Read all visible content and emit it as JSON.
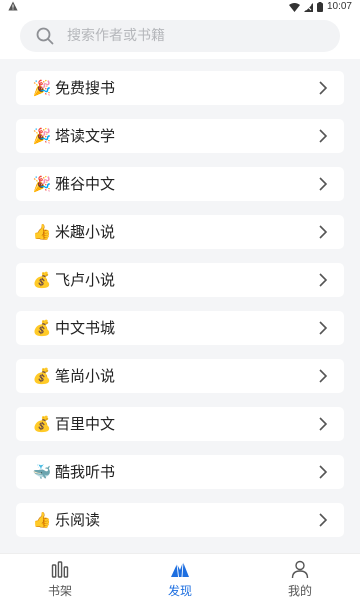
{
  "status_bar": {
    "time": "10:07",
    "icons": [
      "warning-icon",
      "wifi-icon",
      "signal-icon",
      "battery-icon"
    ]
  },
  "search": {
    "placeholder": "搜索作者或书籍",
    "icon": "search-icon"
  },
  "items": [
    {
      "emoji": "🎉",
      "label": "免费搜书",
      "icon": "party-popper-icon"
    },
    {
      "emoji": "🎉",
      "label": "塔读文学",
      "icon": "party-popper-icon"
    },
    {
      "emoji": "🎉",
      "label": "雅谷中文",
      "icon": "party-popper-icon"
    },
    {
      "emoji": "👍",
      "label": "米趣小说",
      "icon": "thumbs-up-icon"
    },
    {
      "emoji": "💰",
      "label": "飞卢小说",
      "icon": "money-bag-icon"
    },
    {
      "emoji": "💰",
      "label": "中文书城",
      "icon": "money-bag-icon"
    },
    {
      "emoji": "💰",
      "label": "笔尚小说",
      "icon": "money-bag-icon"
    },
    {
      "emoji": "💰",
      "label": "百里中文",
      "icon": "money-bag-icon"
    },
    {
      "emoji": "🐳",
      "label": "酷我听书",
      "icon": "whale-icon"
    },
    {
      "emoji": "👍",
      "label": "乐阅读",
      "icon": "thumbs-up-icon"
    }
  ],
  "tabs": [
    {
      "label": "书架",
      "icon": "bookshelf-icon",
      "active": false
    },
    {
      "label": "发现",
      "icon": "discover-icon",
      "active": true
    },
    {
      "label": "我的",
      "icon": "profile-icon",
      "active": false
    }
  ],
  "colors": {
    "accent": "#1e6fe0",
    "background": "#f4f5f7",
    "card": "#ffffff",
    "placeholder": "#b5b7bb"
  }
}
